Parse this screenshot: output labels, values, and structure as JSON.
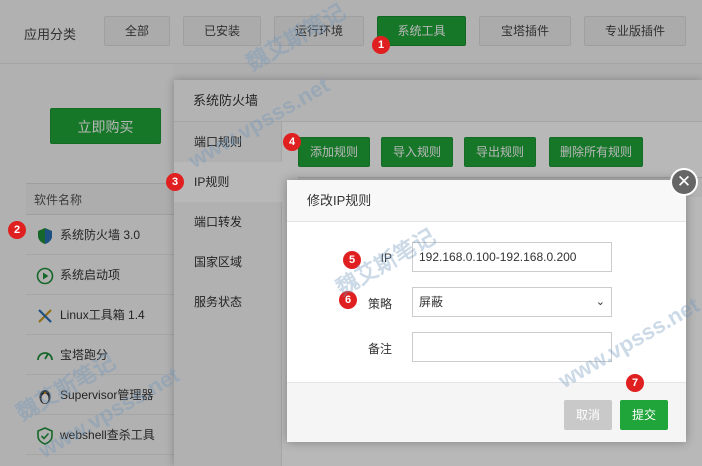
{
  "topbar": {
    "label": "应用分类",
    "categories": [
      "全部",
      "已安装",
      "运行环境",
      "系统工具",
      "宝塔插件",
      "专业版插件"
    ]
  },
  "left": {
    "buy_label": "立即购买",
    "column_header": "软件名称",
    "software": [
      "系统防火墙 3.0",
      "系统启动项",
      "Linux工具箱 1.4",
      "宝塔跑分",
      "Supervisor管理器",
      "webshell查杀工具"
    ]
  },
  "dialog": {
    "title": "系统防火墙",
    "side_items": [
      "端口规则",
      "IP规则",
      "端口转发",
      "国家区域",
      "服务状态"
    ],
    "actions": [
      "添加规则",
      "导入规则",
      "导出规则",
      "删除所有规则"
    ]
  },
  "modal": {
    "title": "修改IP规则",
    "ip_label": "IP",
    "ip_value": "192.168.0.100-192.168.0.200",
    "strategy_label": "策略",
    "strategy_value": "屏蔽",
    "note_label": "备注",
    "note_value": "",
    "cancel_label": "取消",
    "submit_label": "提交"
  },
  "badges": [
    "1",
    "2",
    "3",
    "4",
    "5",
    "6",
    "7"
  ],
  "watermarks": [
    "魏艾斯笔记",
    "www.vpsss.net",
    "魏艾斯笔记",
    "www.vpsss.net",
    "魏艾斯笔记",
    "www.vpsss.net"
  ],
  "colors": {
    "accent": "#20a53a",
    "badge": "#e02020"
  }
}
